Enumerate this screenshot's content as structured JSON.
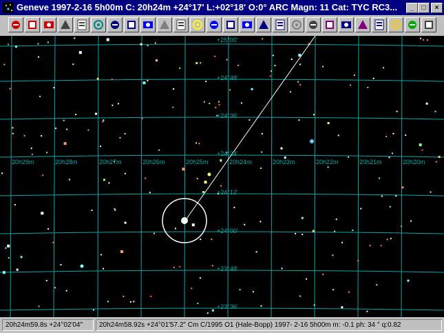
{
  "window": {
    "title": "Geneve 1997-2-16    5h00m C: 20h24m +24°17' L:+02°18' O:0° ARC Magn: 11 Cat: TYC RC3...",
    "minimize_symbol": "_",
    "maximize_symbol": "□",
    "close_symbol": "×"
  },
  "toolbar": {
    "buttons": [
      {
        "name": "zoom-in-icon",
        "color": "#cc0000"
      },
      {
        "name": "zoom-out-icon",
        "color": "#cc0000"
      },
      {
        "name": "zoom-reset-icon",
        "color": "#cc0000"
      },
      {
        "name": "film-strip-icon",
        "color": "#444444"
      },
      {
        "name": "film-strip-2-icon",
        "color": "#444444"
      },
      {
        "name": "binoculars-icon",
        "color": "#008080"
      },
      {
        "name": "star-field-icon",
        "color": "#000080"
      },
      {
        "name": "grid-icon",
        "color": "#000080"
      },
      {
        "name": "dome-icon",
        "color": "#0000ff"
      },
      {
        "name": "grey-figure-icon",
        "color": "#808080"
      },
      {
        "name": "galaxy-icon",
        "color": "#404040"
      },
      {
        "name": "lightbulb-icon",
        "color": "#ffff00"
      },
      {
        "name": "compass-icon",
        "color": "#0000ff"
      },
      {
        "name": "spiral-icon",
        "color": "#000080"
      },
      {
        "name": "constellation-icon",
        "color": "#0000ff"
      },
      {
        "name": "stars-icon",
        "color": "#000080"
      },
      {
        "name": "catalog-icon",
        "color": "#000080"
      },
      {
        "name": "spreadsheet-icon",
        "color": "#808080"
      },
      {
        "name": "printer-icon",
        "color": "#404040"
      },
      {
        "name": "print-preview-icon",
        "color": "#800080"
      },
      {
        "name": "save-icon",
        "color": "#000080"
      },
      {
        "name": "disk-icon",
        "color": "#800080"
      },
      {
        "name": "disk-2-icon",
        "color": "#000080"
      },
      {
        "name": "help-icon",
        "color": "#ffcc00"
      },
      {
        "name": "runner-icon",
        "color": "#00aa00"
      },
      {
        "name": "exit-icon",
        "color": "#404040"
      }
    ]
  },
  "sky": {
    "background": "#000000",
    "grid_color": "#0aa6a6",
    "ra_labels": [
      "20h29m",
      "20h28m",
      "20h27m",
      "20h26m",
      "20h25m",
      "20h24m",
      "20h23m",
      "20h22m",
      "20h21m",
      "20h20m"
    ],
    "dec_labels": [
      "+25°00'",
      "+24°48'",
      "+24°36'",
      "+24°24'",
      "+24°12'",
      "+24°00'",
      "+23°48'",
      "+23°36'"
    ],
    "comet_name": "C/1995 O1 (Hale-Bopp)"
  },
  "status": {
    "cursor": "20h24m59.8s +24°02'04\"",
    "object_info": "20h24m58.92s +24°01'57.2\"  Cm C/1995 O1 (Hale-Bopp) 1997- 2-16   5h00m m: -0.1 ph:  34 ° q:0.82"
  }
}
